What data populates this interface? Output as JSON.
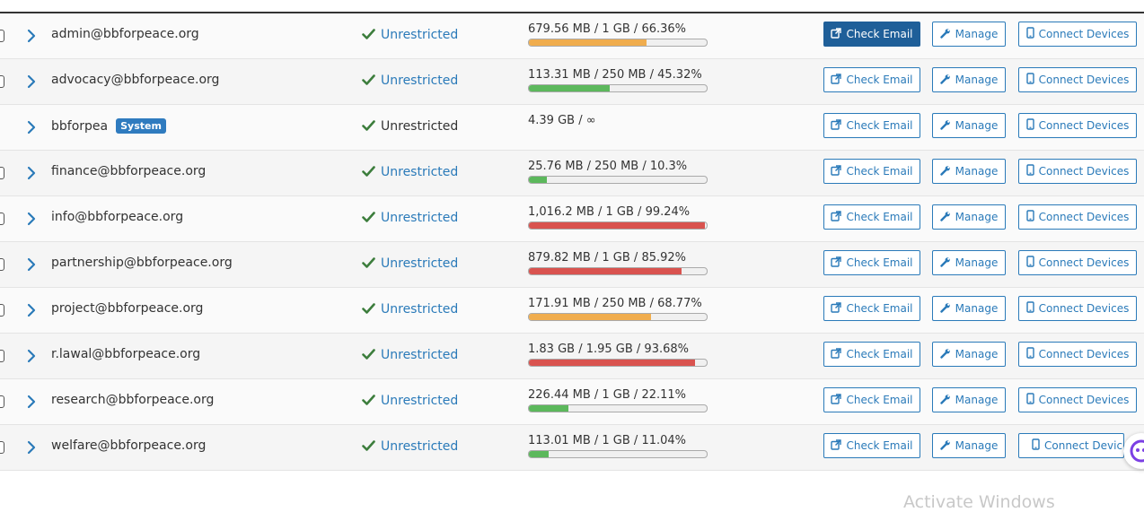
{
  "colors": {
    "link": "#2a7ab9",
    "primary_button": "#1f5f99",
    "usage_orange": "#f0ad4e",
    "usage_green": "#5cb85c",
    "usage_red": "#d9534f",
    "badge": "#2f7bbf",
    "check_green": "#3c7d3c"
  },
  "icons": {
    "row_expand": "chevron-right-icon",
    "restriction": "checkmark-icon",
    "check_email": "external-link-icon",
    "manage": "wrench-icon",
    "connect_devices": "mobile-phone-icon"
  },
  "accounts": [
    {
      "name": "admin@bbforpeace.org",
      "badge": "",
      "restriction": "Unrestricted",
      "restriction_is_link": true,
      "usage": "679.56 MB / 1 GB / 66.36%",
      "percent": 66.36,
      "bar_color": "orange",
      "show_bar": true,
      "check_email_primary": true,
      "check_email_label": "Check Email",
      "manage_label": "Manage",
      "connect_label": "Connect Devices"
    },
    {
      "name": "advocacy@bbforpeace.org",
      "badge": "",
      "restriction": "Unrestricted",
      "restriction_is_link": true,
      "usage": "113.31 MB / 250 MB / 45.32%",
      "percent": 45.32,
      "bar_color": "green",
      "show_bar": true,
      "check_email_primary": false,
      "check_email_label": "Check Email",
      "manage_label": "Manage",
      "connect_label": "Connect Devices"
    },
    {
      "name": "bbforpea",
      "badge": "System",
      "restriction": "Unrestricted",
      "restriction_is_link": false,
      "usage": "4.39 GB / ∞",
      "percent": 0,
      "bar_color": "green",
      "show_bar": false,
      "check_email_primary": false,
      "check_email_label": "Check Email",
      "manage_label": "Manage",
      "connect_label": "Connect Devices"
    },
    {
      "name": "finance@bbforpeace.org",
      "badge": "",
      "restriction": "Unrestricted",
      "restriction_is_link": true,
      "usage": "25.76 MB / 250 MB / 10.3%",
      "percent": 10.3,
      "bar_color": "green",
      "show_bar": true,
      "check_email_primary": false,
      "check_email_label": "Check Email",
      "manage_label": "Manage",
      "connect_label": "Connect Devices"
    },
    {
      "name": "info@bbforpeace.org",
      "badge": "",
      "restriction": "Unrestricted",
      "restriction_is_link": true,
      "usage": "1,016.2 MB / 1 GB / 99.24%",
      "percent": 99.24,
      "bar_color": "red",
      "show_bar": true,
      "check_email_primary": false,
      "check_email_label": "Check Email",
      "manage_label": "Manage",
      "connect_label": "Connect Devices"
    },
    {
      "name": "partnership@bbforpeace.org",
      "badge": "",
      "restriction": "Unrestricted",
      "restriction_is_link": true,
      "usage": "879.82 MB / 1 GB / 85.92%",
      "percent": 85.92,
      "bar_color": "red",
      "show_bar": true,
      "check_email_primary": false,
      "check_email_label": "Check Email",
      "manage_label": "Manage",
      "connect_label": "Connect Devices"
    },
    {
      "name": "project@bbforpeace.org",
      "badge": "",
      "restriction": "Unrestricted",
      "restriction_is_link": true,
      "usage": "171.91 MB / 250 MB / 68.77%",
      "percent": 68.77,
      "bar_color": "orange",
      "show_bar": true,
      "check_email_primary": false,
      "check_email_label": "Check Email",
      "manage_label": "Manage",
      "connect_label": "Connect Devices"
    },
    {
      "name": "r.lawal@bbforpeace.org",
      "badge": "",
      "restriction": "Unrestricted",
      "restriction_is_link": true,
      "usage": "1.83 GB / 1.95 GB / 93.68%",
      "percent": 93.68,
      "bar_color": "red",
      "show_bar": true,
      "check_email_primary": false,
      "check_email_label": "Check Email",
      "manage_label": "Manage",
      "connect_label": "Connect Devices"
    },
    {
      "name": "research@bbforpeace.org",
      "badge": "",
      "restriction": "Unrestricted",
      "restriction_is_link": true,
      "usage": "226.44 MB / 1 GB / 22.11%",
      "percent": 22.11,
      "bar_color": "green",
      "show_bar": true,
      "check_email_primary": false,
      "check_email_label": "Check Email",
      "manage_label": "Manage",
      "connect_label": "Connect Devices"
    },
    {
      "name": "welfare@bbforpeace.org",
      "badge": "",
      "restriction": "Unrestricted",
      "restriction_is_link": true,
      "usage": "113.01 MB / 1 GB / 11.04%",
      "percent": 11.04,
      "bar_color": "green",
      "show_bar": true,
      "check_email_primary": false,
      "check_email_label": "Check Email",
      "manage_label": "Manage",
      "connect_label": "Connect Device"
    }
  ],
  "watermark": "Activate Windows"
}
